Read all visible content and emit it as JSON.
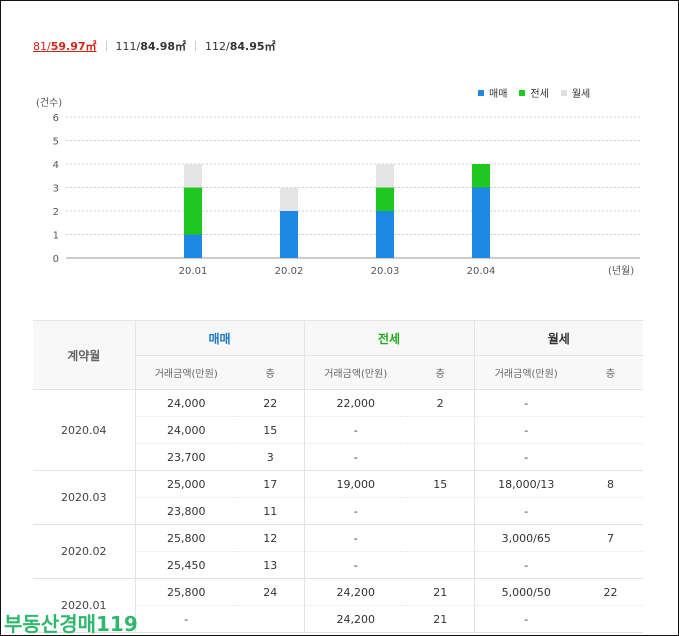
{
  "size_tabs": [
    {
      "type_no": "81",
      "area": "59.97㎡",
      "active": true
    },
    {
      "type_no": "111",
      "area": "84.98㎡",
      "active": false
    },
    {
      "type_no": "112",
      "area": "84.95㎡",
      "active": false
    }
  ],
  "legend": [
    {
      "label": "매매",
      "color": "#1e88e5"
    },
    {
      "label": "전세",
      "color": "#1ec81e"
    },
    {
      "label": "월세",
      "color": "#e0e0e0"
    }
  ],
  "chart_data": {
    "type": "bar",
    "stacked": true,
    "categories": [
      "20.01",
      "20.02",
      "20.03",
      "20.04"
    ],
    "series": [
      {
        "name": "매매",
        "values": [
          1,
          2,
          2,
          3
        ],
        "color": "#1e88e5"
      },
      {
        "name": "전세",
        "values": [
          2,
          0,
          1,
          1
        ],
        "color": "#1ec81e"
      },
      {
        "name": "월세",
        "values": [
          1,
          1,
          1,
          0
        ],
        "color": "#e4e4e4"
      }
    ],
    "ylabel": "(건수)",
    "xlabel": "(년월)",
    "ylim": [
      0,
      6
    ],
    "yticks": [
      "0",
      "1",
      "2",
      "3",
      "4",
      "5",
      "6"
    ],
    "grid": true,
    "legend_position": "top-right"
  },
  "table": {
    "month_header": "계약월",
    "groups": [
      {
        "label": "매매",
        "color": "#1a78c2"
      },
      {
        "label": "전세",
        "color": "#24a820"
      },
      {
        "label": "월세",
        "color": "#333333"
      }
    ],
    "sub_headers": {
      "price": "거래금액(만원)",
      "floor": "층"
    },
    "months": [
      {
        "month": "2020.04",
        "rows": [
          {
            "sale_price": "24,000",
            "sale_floor": "22",
            "jeonse_price": "22,000",
            "jeonse_floor": "2",
            "rent_price": "-",
            "rent_floor": ""
          },
          {
            "sale_price": "24,000",
            "sale_floor": "15",
            "jeonse_price": "-",
            "jeonse_floor": "",
            "rent_price": "-",
            "rent_floor": ""
          },
          {
            "sale_price": "23,700",
            "sale_floor": "3",
            "jeonse_price": "-",
            "jeonse_floor": "",
            "rent_price": "-",
            "rent_floor": ""
          }
        ]
      },
      {
        "month": "2020.03",
        "rows": [
          {
            "sale_price": "25,000",
            "sale_floor": "17",
            "jeonse_price": "19,000",
            "jeonse_floor": "15",
            "rent_price": "18,000/13",
            "rent_floor": "8"
          },
          {
            "sale_price": "23,800",
            "sale_floor": "11",
            "jeonse_price": "-",
            "jeonse_floor": "",
            "rent_price": "-",
            "rent_floor": ""
          }
        ]
      },
      {
        "month": "2020.02",
        "rows": [
          {
            "sale_price": "25,800",
            "sale_floor": "12",
            "jeonse_price": "-",
            "jeonse_floor": "",
            "rent_price": "3,000/65",
            "rent_floor": "7"
          },
          {
            "sale_price": "25,450",
            "sale_floor": "13",
            "jeonse_price": "-",
            "jeonse_floor": "",
            "rent_price": "-",
            "rent_floor": ""
          }
        ]
      },
      {
        "month": "2020.01",
        "rows": [
          {
            "sale_price": "25,800",
            "sale_floor": "24",
            "jeonse_price": "24,200",
            "jeonse_floor": "21",
            "rent_price": "5,000/50",
            "rent_floor": "22"
          },
          {
            "sale_price": "-",
            "sale_floor": "",
            "jeonse_price": "24,200",
            "jeonse_floor": "21",
            "rent_price": "-",
            "rent_floor": ""
          }
        ]
      }
    ]
  },
  "watermark": "부동산경매119"
}
